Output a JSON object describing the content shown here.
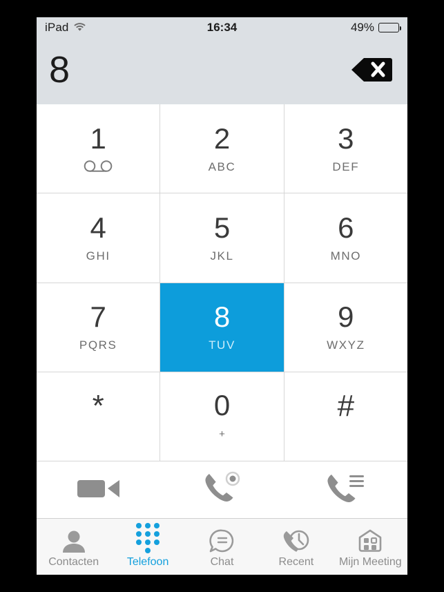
{
  "statusbar": {
    "carrier": "iPad",
    "wifi_icon": "wifi-icon",
    "time": "16:34",
    "battery_percent": "49%",
    "battery_icon": "battery-icon"
  },
  "display": {
    "dialed_number": "8",
    "delete_icon": "backspace-delete-icon"
  },
  "keypad": {
    "keys": [
      {
        "digit": "1",
        "letters": "",
        "icon": "voicemail-icon",
        "active": false
      },
      {
        "digit": "2",
        "letters": "ABC",
        "icon": "",
        "active": false
      },
      {
        "digit": "3",
        "letters": "DEF",
        "icon": "",
        "active": false
      },
      {
        "digit": "4",
        "letters": "GHI",
        "icon": "",
        "active": false
      },
      {
        "digit": "5",
        "letters": "JKL",
        "icon": "",
        "active": false
      },
      {
        "digit": "6",
        "letters": "MNO",
        "icon": "",
        "active": false
      },
      {
        "digit": "7",
        "letters": "PQRS",
        "icon": "",
        "active": false
      },
      {
        "digit": "8",
        "letters": "TUV",
        "icon": "",
        "active": true
      },
      {
        "digit": "9",
        "letters": "WXYZ",
        "icon": "",
        "active": false
      },
      {
        "digit": "*",
        "letters": "",
        "icon": "",
        "active": false
      },
      {
        "digit": "0",
        "letters": "+",
        "icon": "",
        "active": false
      },
      {
        "digit": "#",
        "letters": "",
        "icon": "",
        "active": false
      }
    ]
  },
  "actions": [
    {
      "name": "video-call-button",
      "icon": "video-camera-icon"
    },
    {
      "name": "voice-call-button",
      "icon": "phone-record-icon"
    },
    {
      "name": "call-options-button",
      "icon": "phone-list-icon"
    }
  ],
  "tabbar": {
    "active_color": "#14a0dd",
    "inactive_color": "#8c8c8c",
    "tabs": [
      {
        "label": "Contacten",
        "icon": "person-icon",
        "active": false
      },
      {
        "label": "Telefoon",
        "icon": "dialpad-icon",
        "active": true
      },
      {
        "label": "Chat",
        "icon": "chat-bubble-icon",
        "active": false
      },
      {
        "label": "Recent",
        "icon": "recent-calls-icon",
        "active": false
      },
      {
        "label": "Mijn Meeting",
        "icon": "my-meeting-icon",
        "active": false
      }
    ]
  }
}
